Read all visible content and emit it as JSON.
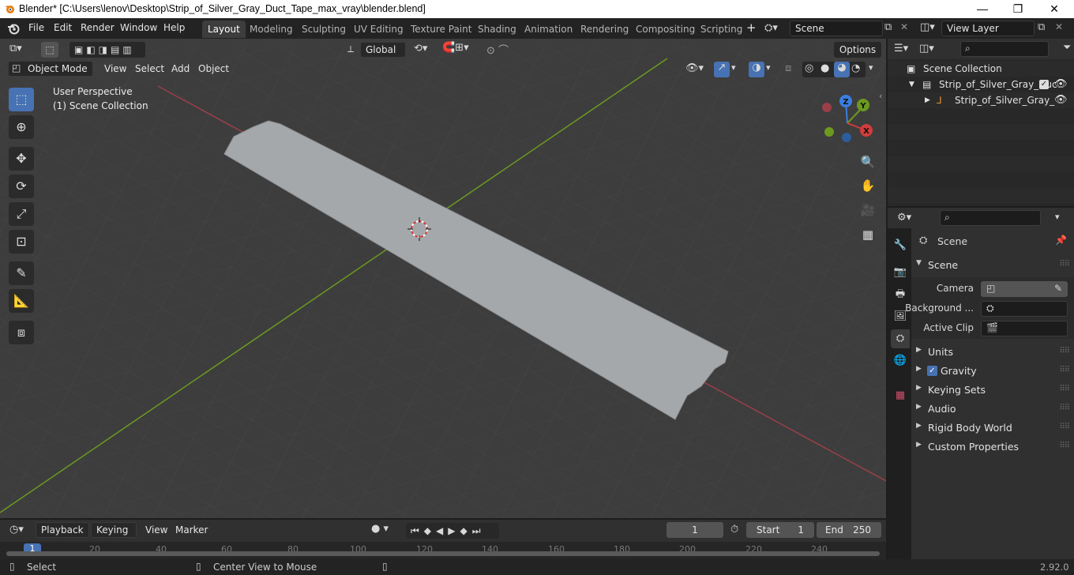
{
  "window": {
    "title": "Blender* [C:\\Users\\lenov\\Desktop\\Strip_of_Silver_Gray_Duct_Tape_max_vray\\blender.blend]",
    "minimize": "—",
    "maximize": "❐",
    "close": "✕"
  },
  "menu": [
    "File",
    "Edit",
    "Render",
    "Window",
    "Help"
  ],
  "workspaces": [
    "Layout",
    "Modeling",
    "Sculpting",
    "UV Editing",
    "Texture Paint",
    "Shading",
    "Animation",
    "Rendering",
    "Compositing",
    "Scripting"
  ],
  "active_workspace": "Layout",
  "scene_field": "Scene",
  "view_layer_field": "View Layer",
  "viewport": {
    "transform_orientation": "Global",
    "options_label": "Options",
    "mode": "Object Mode",
    "header_menus": [
      "View",
      "Select",
      "Add",
      "Object"
    ],
    "overlay_line1": "User Perspective",
    "overlay_line2": "(1) Scene Collection",
    "gizmo": {
      "x": "X",
      "y": "Y",
      "z": "Z"
    }
  },
  "outliner": {
    "root": "Scene Collection",
    "collection": "Strip_of_Silver_Gray_Duc",
    "object": "Strip_of_Silver_Gray_"
  },
  "properties": {
    "context": "Scene",
    "panel": "Scene",
    "camera_label": "Camera",
    "background_label": "Background ...",
    "active_clip_label": "Active Clip",
    "subpanels": [
      "Units",
      "Gravity",
      "Keying Sets",
      "Audio",
      "Rigid Body World",
      "Custom Properties"
    ],
    "gravity_checked": true
  },
  "timeline": {
    "menus": [
      "Playback",
      "Keying",
      "View",
      "Marker"
    ],
    "current_frame": "1",
    "start_label": "Start",
    "start_value": "1",
    "end_label": "End",
    "end_value": "250",
    "ruler": [
      "1",
      "20",
      "40",
      "60",
      "80",
      "100",
      "120",
      "140",
      "160",
      "180",
      "200",
      "220",
      "240"
    ]
  },
  "status": {
    "left": "Select",
    "middle": "Center View to Mouse",
    "version": "2.92.0"
  },
  "colors": {
    "accent": "#4772b3",
    "x_axis": "#9a3f4a",
    "y_axis": "#6b9a1f",
    "z_axis": "#3a7fe0"
  }
}
